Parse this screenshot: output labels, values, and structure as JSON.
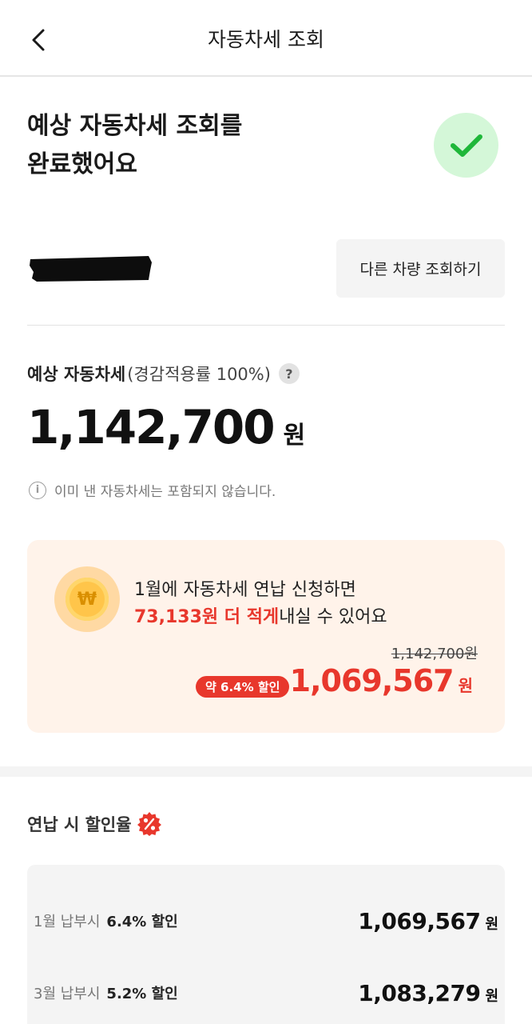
{
  "header": {
    "title": "자동차세 조회",
    "back_icon": "chevron-left-icon"
  },
  "result": {
    "title": "예상 자동차세 조회를\n완료했어요",
    "status_icon": "check-icon",
    "status_color": "#1fb73a"
  },
  "vehicle": {
    "other_car_button": "다른 차량 조회하기"
  },
  "tax": {
    "label_main": "예상 자동차세",
    "label_sub": "(경감적용률 100%)",
    "help_icon_text": "?",
    "amount": "1,142,700",
    "unit": "원",
    "notice": "이미 낸 자동차세는 포함되지 않습니다.",
    "notice_icon_text": "i"
  },
  "promo": {
    "coin_symbol": "₩",
    "line1": "1월에 자동차세 연납 신청하면",
    "line2_highlight": "73,133원 더 적게",
    "line2_rest": "내실 수 있어요",
    "original_price": "1,142,700원",
    "discount_badge": "약 6.4% 할인",
    "discounted_amount": "1,069,567",
    "unit": "원",
    "accent_color": "#e8372c"
  },
  "rates": {
    "title": "연납 시 할인율",
    "badge_icon": "percent-badge-icon",
    "rows": [
      {
        "month": "1월 납부시",
        "discount": "6.4% 할인",
        "amount": "1,069,567",
        "unit": "원"
      },
      {
        "month": "3월 납부시",
        "discount": "5.2% 할인",
        "amount": "1,083,279",
        "unit": "원"
      }
    ]
  }
}
